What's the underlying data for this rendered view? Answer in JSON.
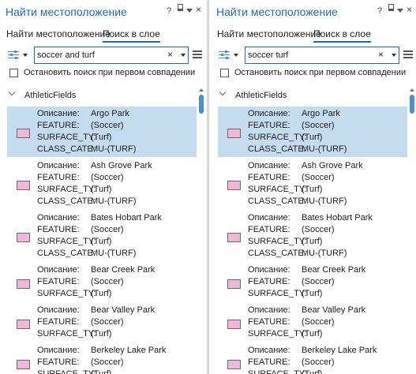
{
  "panes": [
    {
      "title": "Найти местоположение",
      "controls": {
        "help": "?",
        "close": "×"
      },
      "tabs": [
        {
          "label": "Найти местоположение",
          "active": false
        },
        {
          "label": "Поиск в слое",
          "active": true
        }
      ],
      "search": {
        "value": "soccer and turf",
        "clear": "×"
      },
      "stop_label": "Остановить поиск при первом совпадении",
      "stop_checked": false,
      "group": "AthleticFields",
      "results": [
        {
          "selected": true,
          "fields": [
            [
              "Описание:",
              "Argo Park"
            ],
            [
              "FEATURE:",
              "(Soccer)"
            ],
            [
              "SURFACE_TY:",
              "(Turf)"
            ],
            [
              "CLASS_CATE:",
              "MU-(TURF)"
            ]
          ]
        },
        {
          "selected": false,
          "fields": [
            [
              "Описание:",
              "Ash Grove Park"
            ],
            [
              "FEATURE:",
              "(Soccer)"
            ],
            [
              "SURFACE_TY:",
              "(Turf)"
            ],
            [
              "CLASS_CATE:",
              "MU-(TURF)"
            ]
          ]
        },
        {
          "selected": false,
          "fields": [
            [
              "Описание:",
              "Bates Hobart Park"
            ],
            [
              "FEATURE:",
              "(Soccer)"
            ],
            [
              "SURFACE_TY:",
              "(Turf)"
            ],
            [
              "CLASS_CATE:",
              "MU-(TURF)"
            ]
          ]
        },
        {
          "selected": false,
          "fields": [
            [
              "Описание:",
              "Bear Creek Park"
            ],
            [
              "FEATURE:",
              "(Soccer)"
            ],
            [
              "SURFACE_TY:",
              "(Turf)"
            ]
          ]
        },
        {
          "selected": false,
          "fields": [
            [
              "Описание:",
              "Bear Valley Park"
            ],
            [
              "FEATURE:",
              "(Soccer)"
            ],
            [
              "SURFACE_TY:",
              "(Turf)"
            ]
          ]
        },
        {
          "selected": false,
          "fields": [
            [
              "Описание:",
              "Berkeley Lake Park"
            ],
            [
              "FEATURE:",
              "(Soccer)"
            ],
            [
              "SURFACE_TY:",
              "(Turf)"
            ]
          ]
        }
      ]
    },
    {
      "title": "Найти местоположение",
      "controls": {
        "help": "?",
        "close": "×"
      },
      "tabs": [
        {
          "label": "Найти местоположение",
          "active": false
        },
        {
          "label": "Поиск в слое",
          "active": true
        }
      ],
      "search": {
        "value": "soccer turf",
        "clear": "×"
      },
      "stop_label": "Остановить поиск при первом совпадении",
      "stop_checked": false,
      "group": "AthleticFields",
      "results": [
        {
          "selected": true,
          "fields": [
            [
              "Описание:",
              "Argo Park"
            ],
            [
              "FEATURE:",
              "(Soccer)"
            ],
            [
              "SURFACE_TY:",
              "(Turf)"
            ],
            [
              "CLASS_CATE:",
              "MU-(TURF)"
            ]
          ]
        },
        {
          "selected": false,
          "fields": [
            [
              "Описание:",
              "Ash Grove Park"
            ],
            [
              "FEATURE:",
              "(Soccer)"
            ],
            [
              "SURFACE_TY:",
              "(Turf)"
            ],
            [
              "CLASS_CATE:",
              "MU-(TURF)"
            ]
          ]
        },
        {
          "selected": false,
          "fields": [
            [
              "Описание:",
              "Bates Hobart Park"
            ],
            [
              "FEATURE:",
              "(Soccer)"
            ],
            [
              "SURFACE_TY:",
              "(Turf)"
            ],
            [
              "CLASS_CATE:",
              "MU-(TURF)"
            ]
          ]
        },
        {
          "selected": false,
          "fields": [
            [
              "Описание:",
              "Bear Creek Park"
            ],
            [
              "FEATURE:",
              "(Soccer)"
            ],
            [
              "SURFACE_TY:",
              "(Turf)"
            ]
          ]
        },
        {
          "selected": false,
          "fields": [
            [
              "Описание:",
              "Bear Valley Park"
            ],
            [
              "FEATURE:",
              "(Soccer)"
            ],
            [
              "SURFACE_TY:",
              "(Turf)"
            ]
          ]
        },
        {
          "selected": false,
          "fields": [
            [
              "Описание:",
              "Berkeley Lake Park"
            ],
            [
              "FEATURE:",
              "(Soccer)"
            ],
            [
              "SURFACE_TY:",
              "(Turf)"
            ]
          ]
        }
      ]
    }
  ],
  "colors": {
    "accent": "#1c6bb8",
    "selection": "#c5dcef",
    "symbol_fill": "#f0b7d8",
    "scrollbar": "#4a90d9"
  },
  "icons": {
    "options": "sliders-icon",
    "menu": "hamburger-menu-icon",
    "pin": "pin-icon",
    "autohide": "auto-hide-icon"
  }
}
